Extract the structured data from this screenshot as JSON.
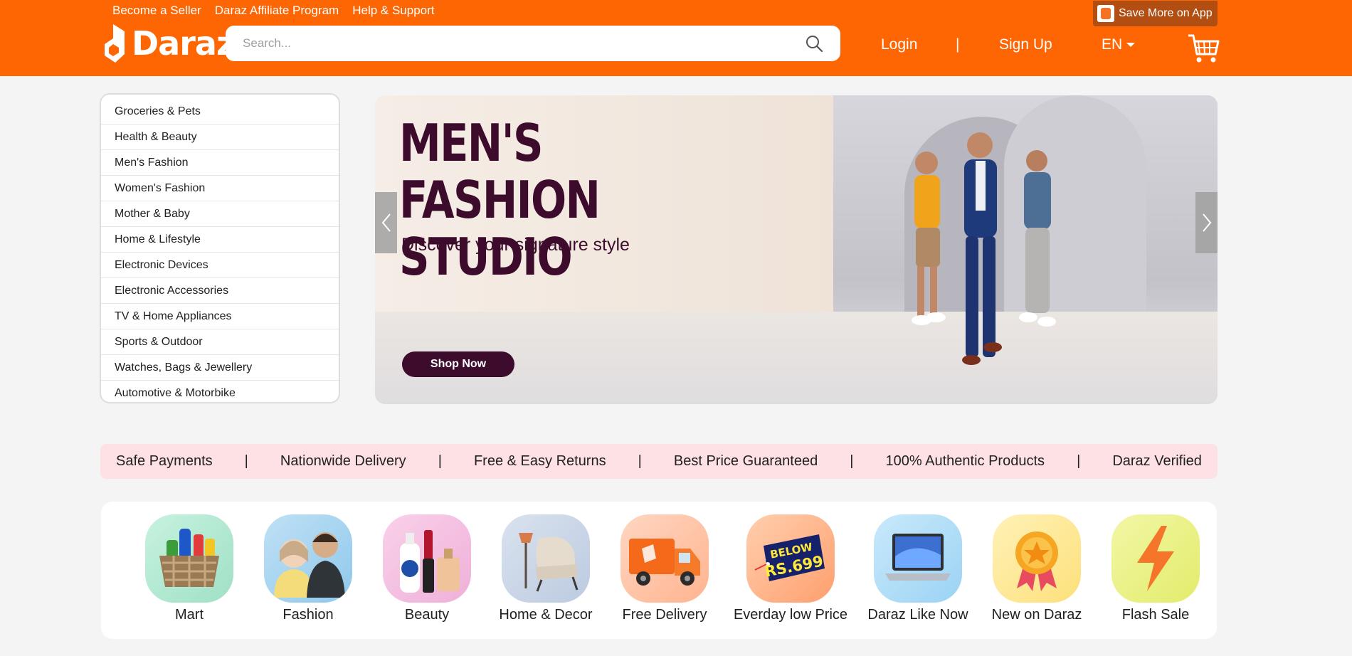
{
  "topbar": {
    "links": [
      "Become a Seller",
      "Daraz Affiliate Program",
      "Help & Support"
    ],
    "app_button": "Save More on App"
  },
  "logo": {
    "text": "Daraz"
  },
  "search": {
    "placeholder": "Search..."
  },
  "nav": {
    "login": "Login",
    "separator": "|",
    "signup": "Sign Up",
    "language": "EN"
  },
  "sidebar": {
    "categories": [
      "Groceries & Pets",
      "Health & Beauty",
      "Men's Fashion",
      "Women's Fashion",
      "Mother & Baby",
      "Home & Lifestyle",
      "Electronic Devices",
      "Electronic Accessories",
      "TV & Home Appliances",
      "Sports & Outdoor",
      "Watches, Bags & Jewellery",
      "Automotive & Motorbike"
    ]
  },
  "banner": {
    "title_line1": "MEN'S FASHION",
    "title_line2": "STUDIO",
    "subtitle": "Discover your signature style",
    "cta": "Shop Now"
  },
  "features": {
    "items": [
      "Safe Payments",
      "Nationwide Delivery",
      "Free & Easy Returns",
      "Best Price Guaranteed",
      "100% Authentic Products",
      "Daraz Verified"
    ],
    "separator": "|"
  },
  "channels": [
    {
      "label": "Mart",
      "icon": "basket-icon"
    },
    {
      "label": "Fashion",
      "icon": "fashion-icon"
    },
    {
      "label": "Beauty",
      "icon": "beauty-icon"
    },
    {
      "label": "Home & Decor",
      "icon": "chair-icon"
    },
    {
      "label": "Free Delivery",
      "icon": "truck-icon"
    },
    {
      "label": "Everday low Price",
      "icon": "price-tag-icon",
      "tag_line1": "BELOW",
      "tag_line2": "RS.699"
    },
    {
      "label": "Daraz Like Now",
      "icon": "laptop-icon"
    },
    {
      "label": "New on Daraz",
      "icon": "medal-icon"
    },
    {
      "label": "Flash Sale",
      "icon": "lightning-icon"
    }
  ],
  "colors": {
    "brand": "#fe6603",
    "banner_text": "#3d0b2c",
    "features_bg": "#fde1e4"
  }
}
